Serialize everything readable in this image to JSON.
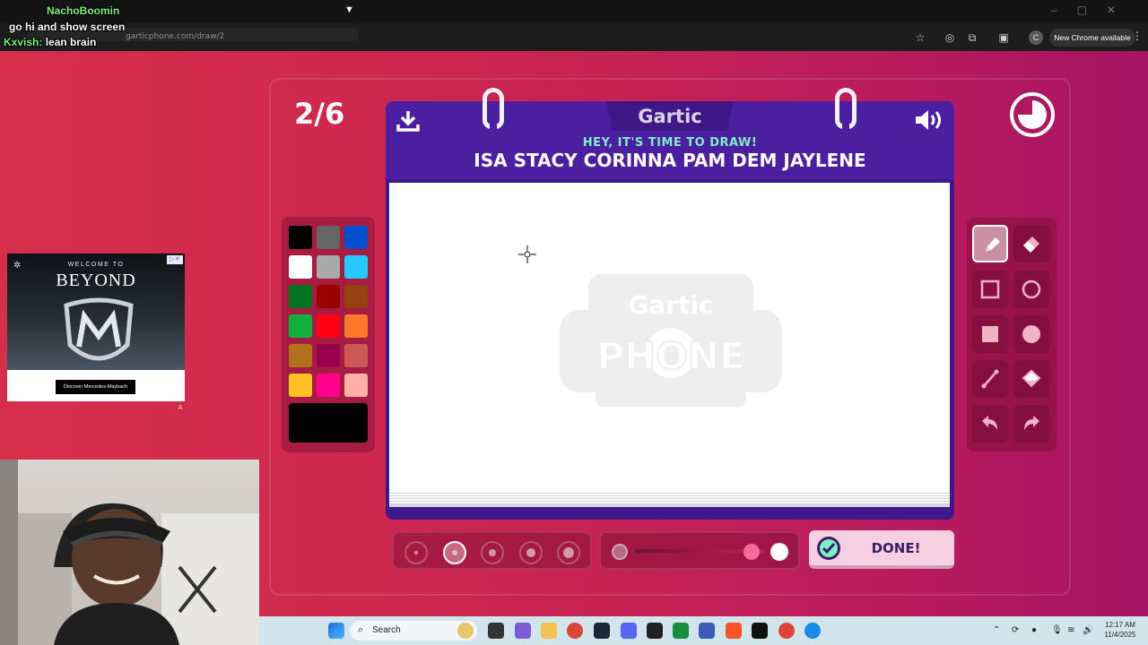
{
  "browser": {
    "url": "garticphone.com/draw/2",
    "new_chrome": "New Chrome available",
    "pin_icon": "pin-icon"
  },
  "chat": [
    {
      "name": "NachoBoomin",
      "message": ""
    },
    {
      "name": "",
      "message": "go hi and show screen"
    },
    {
      "name": "Kxvish:",
      "message": "lean brain"
    }
  ],
  "game": {
    "round": "2/6",
    "logo": "Gartic",
    "time_to_draw": "HEY, IT'S TIME TO DRAW!",
    "prompt": "ISA STACY CORINNA PAM DEM JAYLENE",
    "watermark_top": "Gartic",
    "watermark_bottom": "PHONE",
    "done_label": "DONE!",
    "timer_fraction": 0.75,
    "selected_size_index": 1,
    "opacity_fraction": 0.9
  },
  "palette": {
    "colors": [
      "#000000",
      "#666666",
      "#0050cd",
      "#ffffff",
      "#aaaaaa",
      "#26c9ff",
      "#017420",
      "#990000",
      "#964112",
      "#11b03c",
      "#ff0013",
      "#ff7829",
      "#b0701c",
      "#99004e",
      "#cb5a57",
      "#ffc126",
      "#ff008f",
      "#feafa8"
    ],
    "current": "#000000"
  },
  "tools": [
    "pen-icon",
    "eraser-icon",
    "square-outline-icon",
    "circle-outline-icon",
    "square-fill-icon",
    "circle-fill-icon",
    "line-icon",
    "bucket-icon",
    "undo-icon",
    "redo-icon"
  ],
  "ad": {
    "welcome": "WELCOME TO",
    "headline": "BEYOND",
    "cta": "Discover Mercedes-Maybach",
    "badge": "A"
  },
  "taskbar": {
    "search_placeholder": "Search",
    "time": "12:17 AM",
    "date": "11/4/2025"
  },
  "colors": {
    "accent_purple": "#4c1fa0",
    "background": "#c8254f",
    "done_bg": "#f6cfe0"
  }
}
